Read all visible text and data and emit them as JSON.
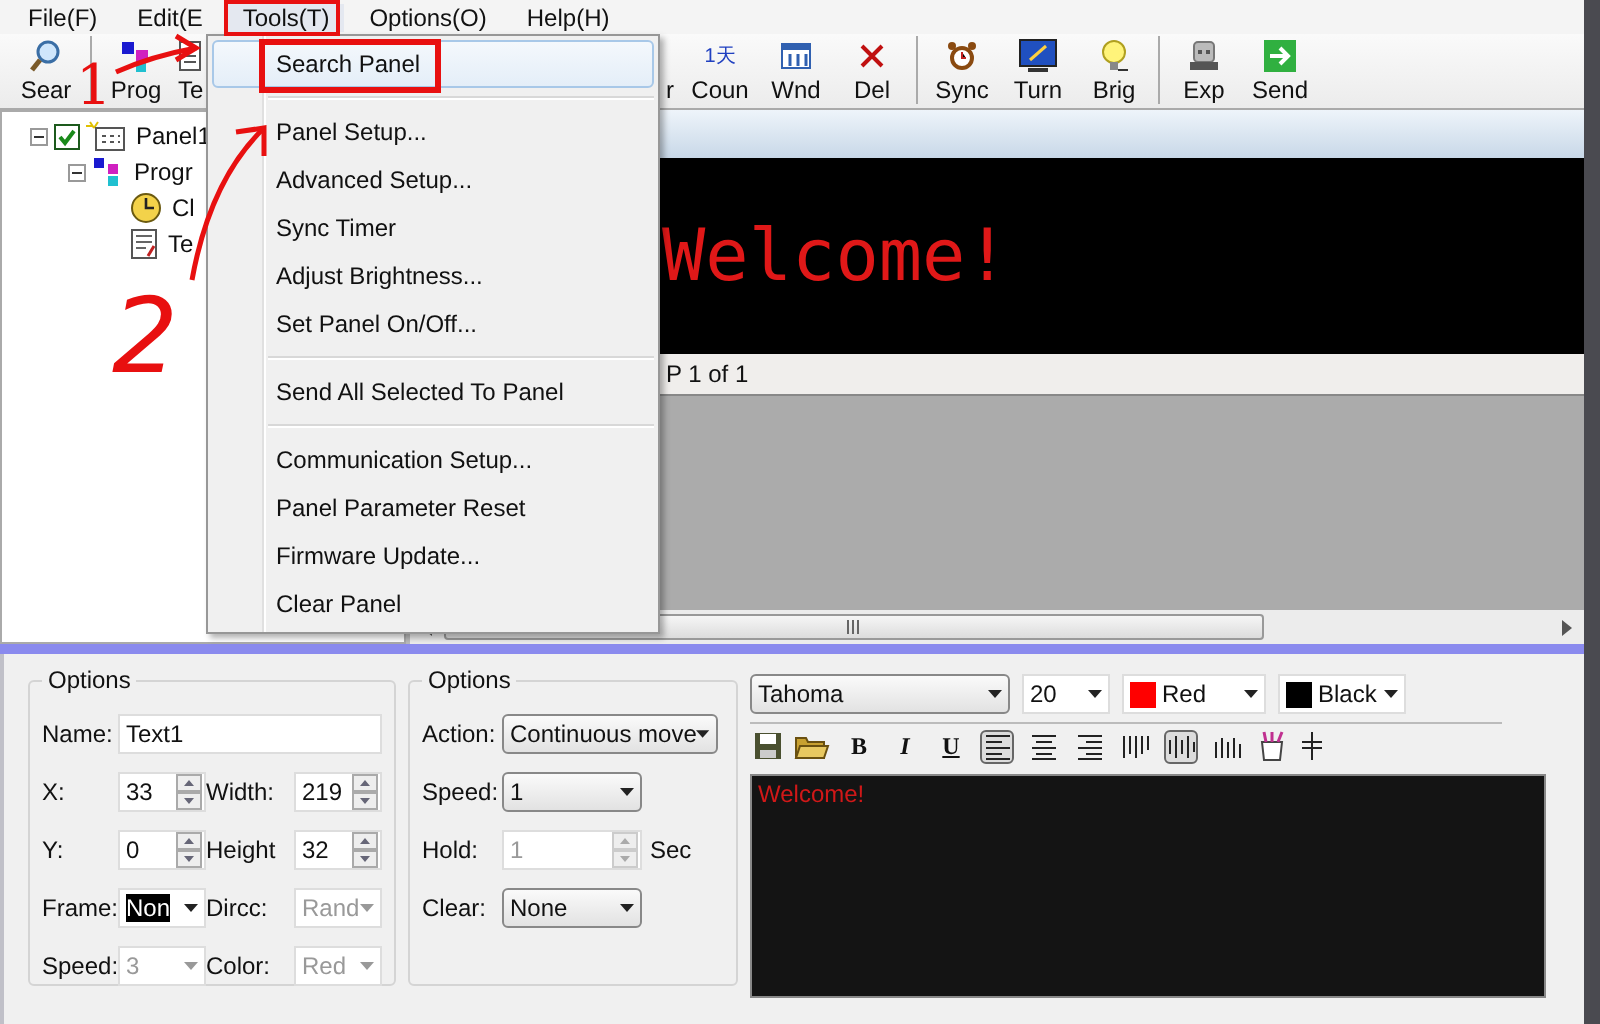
{
  "menubar": [
    {
      "label": "File(F)",
      "selected": false
    },
    {
      "label": "Edit(E",
      "selected": false
    },
    {
      "label": "Tools(T)",
      "selected": true
    },
    {
      "label": "Options(O)",
      "selected": false
    },
    {
      "label": "Help(H)",
      "selected": false
    }
  ],
  "toolbar": [
    {
      "label": "Sear"
    },
    {
      "label": "Prog"
    },
    {
      "label": "Te"
    },
    {
      "label": "r"
    },
    {
      "label": "Coun",
      "icon_text": "1天"
    },
    {
      "label": "Wnd"
    },
    {
      "label": "Del"
    },
    {
      "label": "Sync"
    },
    {
      "label": "Turn"
    },
    {
      "label": "Brig"
    },
    {
      "label": "Exp"
    },
    {
      "label": "Send"
    }
  ],
  "tree": [
    {
      "label": "Panel1",
      "checked": true,
      "expanded": true,
      "children": [
        {
          "label": "Progr",
          "expanded": true,
          "children": [
            {
              "label": "Cl"
            },
            {
              "label": "Te"
            }
          ]
        }
      ]
    }
  ],
  "menu": [
    {
      "kind": "item",
      "label": "Search Panel",
      "selected": true
    },
    {
      "kind": "separator"
    },
    {
      "kind": "item",
      "label": "Panel Setup...",
      "selected": false
    },
    {
      "kind": "item",
      "label": "Advanced Setup...",
      "selected": false
    },
    {
      "kind": "item",
      "label": "Sync Timer",
      "selected": false
    },
    {
      "kind": "item",
      "label": "Adjust Brightness...",
      "selected": false
    },
    {
      "kind": "item",
      "label": "Set Panel On/Off...",
      "selected": false
    },
    {
      "kind": "separator"
    },
    {
      "kind": "item",
      "label": "Send All Selected To Panel",
      "selected": false
    },
    {
      "kind": "separator"
    },
    {
      "kind": "item",
      "label": "Communication Setup...",
      "selected": false
    },
    {
      "kind": "item",
      "label": "Panel Parameter Reset",
      "selected": false
    },
    {
      "kind": "item",
      "label": "Firmware Update...",
      "selected": false
    },
    {
      "kind": "item",
      "label": "Clear Panel",
      "selected": false
    }
  ],
  "preview": {
    "text": "Welcome!",
    "page": "P 1 of 1"
  },
  "annotations": [
    "1",
    "2"
  ],
  "options": {
    "title": "Options",
    "name_label": "Name:",
    "name_value": "Text1",
    "x_label": "X:",
    "x_value": "33",
    "width_label": "Width:",
    "width_value": "219",
    "y_label": "Y:",
    "y_value": "0",
    "height_label": "Height",
    "height_value": "32",
    "frame_label": "Frame:",
    "frame_value": "Non",
    "frame_focused": true,
    "dircc_label": "Dircc:",
    "dircc_value": "Rand",
    "dircc_disabled": true,
    "speed_label": "Speed:",
    "speed_value": "3",
    "speed_disabled": true,
    "color_label": "Color:",
    "color_value": "Red",
    "color_disabled": true
  },
  "options2": {
    "title": "Options",
    "action_label": "Action:",
    "action_value": "Continuous move",
    "speed_label": "Speed:",
    "speed_value": "1",
    "hold_label": "Hold:",
    "hold_value": "1",
    "hold_disabled": true,
    "hold_unit": "Sec",
    "clear_label": "Clear:",
    "clear_value": "None"
  },
  "editor": {
    "font": "Tahoma",
    "size": "20",
    "fg": {
      "label": "Red",
      "color": "#ff0000"
    },
    "bg": {
      "label": "Black",
      "color": "#000000"
    },
    "letters": [
      "B",
      "I",
      "U"
    ],
    "align": [
      {
        "selected": true
      },
      {
        "selected": false
      },
      {
        "selected": false
      }
    ],
    "valign": [
      {
        "selected": false
      },
      {
        "selected": true
      },
      {
        "selected": false
      }
    ],
    "text": "Welcome!"
  }
}
